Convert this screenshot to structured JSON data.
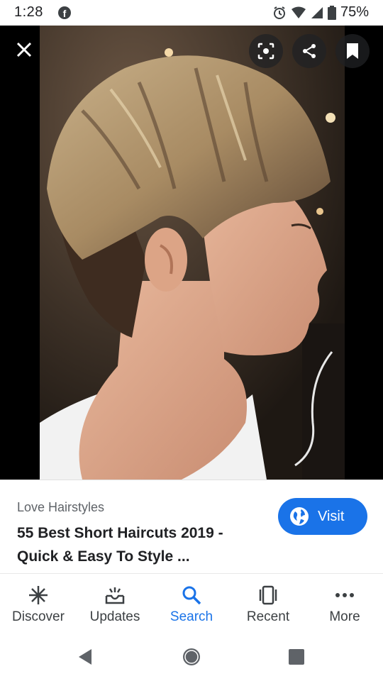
{
  "status_bar": {
    "time": "1:28",
    "battery": "75%",
    "icons": [
      "facebook-icon",
      "alarm-icon",
      "wifi-icon",
      "signal-icon",
      "battery-icon"
    ]
  },
  "viewer": {
    "icons": [
      "close-icon",
      "lens-icon",
      "share-icon",
      "bookmark-icon"
    ]
  },
  "result": {
    "source": "Love Hairstyles",
    "title": "55 Best Short Haircuts 2019 - Quick & Easy To Style ...",
    "visit_label": "Visit"
  },
  "bottom_nav": {
    "items": [
      {
        "label": "Discover",
        "icon": "discover-icon",
        "active": false
      },
      {
        "label": "Updates",
        "icon": "updates-icon",
        "active": false
      },
      {
        "label": "Search",
        "icon": "search-icon",
        "active": true
      },
      {
        "label": "Recent",
        "icon": "recent-icon",
        "active": false
      },
      {
        "label": "More",
        "icon": "more-icon",
        "active": false
      }
    ]
  },
  "colors": {
    "accent": "#1a73e8",
    "text_primary": "#202124",
    "text_secondary": "#5f6368"
  }
}
